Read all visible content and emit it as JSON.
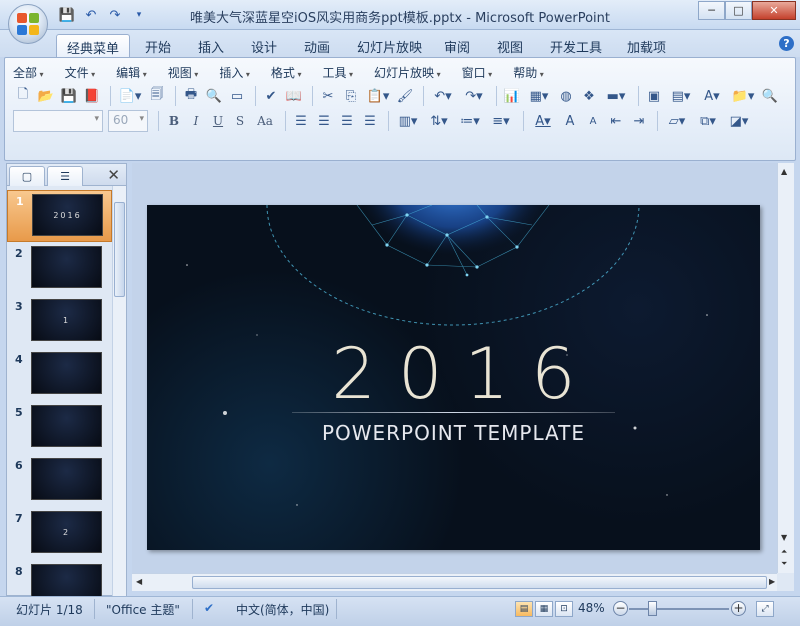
{
  "window": {
    "title": "唯美大气深蓝星空iOS风实用商务ppt模板.pptx - Microsoft PowerPoint",
    "minimize": "─",
    "maximize": "□",
    "close": "✕"
  },
  "qat": [
    "save-icon",
    "undo-icon",
    "redo-icon",
    "customize-icon"
  ],
  "tabs": [
    "经典菜单",
    "开始",
    "插入",
    "设计",
    "动画",
    "幻灯片放映",
    "审阅",
    "视图",
    "开发工具",
    "加载项"
  ],
  "active_tab": "经典菜单",
  "help": "?",
  "menus": [
    "全部",
    "文件",
    "编辑",
    "视图",
    "插入",
    "格式",
    "工具",
    "幻灯片放映",
    "窗口",
    "帮助"
  ],
  "font": {
    "name": "",
    "size": "60"
  },
  "format_buttons": [
    "B",
    "I",
    "U",
    "S",
    "Aa"
  ],
  "left_panel": {
    "tab_slides": "▢",
    "tab_outline": "☰",
    "close": "✕",
    "thumbnails": [
      {
        "num": "1",
        "label": "2016",
        "selected": true
      },
      {
        "num": "2",
        "label": "",
        "selected": false
      },
      {
        "num": "3",
        "label": "1",
        "selected": false
      },
      {
        "num": "4",
        "label": "",
        "selected": false
      },
      {
        "num": "5",
        "label": "",
        "selected": false
      },
      {
        "num": "6",
        "label": "",
        "selected": false
      },
      {
        "num": "7",
        "label": "2",
        "selected": false
      },
      {
        "num": "8",
        "label": "",
        "selected": false
      }
    ]
  },
  "slide": {
    "year": "2016",
    "subtitle": "POWERPOINT  TEMPLATE"
  },
  "status": {
    "slide_info": "幻灯片 1/18",
    "theme": "\"Office 主题\"",
    "language": "中文(简体，中国)",
    "zoom": "48%"
  },
  "colors": {
    "slide_bg": "#07101c",
    "accent_glow": "#2a6fd6",
    "title_text": "#e9e4d4"
  }
}
